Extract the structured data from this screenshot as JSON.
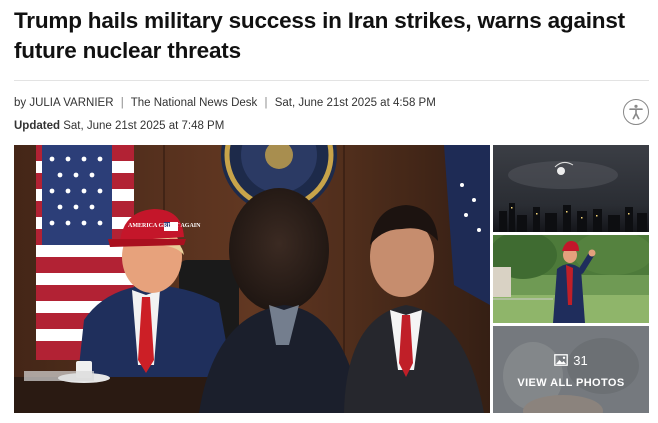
{
  "article": {
    "headline": "Trump hails military success in Iran strikes, warns against future nuclear threats",
    "byline": {
      "prefix": "by",
      "author": "JULIA VARNIER",
      "outlet": "The National News Desk",
      "published": "Sat, June 21st 2025 at 4:58 PM"
    },
    "updated": {
      "label": "Updated",
      "value": "Sat, June 21st 2025 at 7:48 PM"
    }
  },
  "accessibility": {
    "icon": "accessibility-icon"
  },
  "gallery": {
    "photo_count": "31",
    "view_all_label": "VIEW ALL PHOTOS",
    "count_icon": "image-icon",
    "hero_hat_text": "AMERICA GREAT AGAIN"
  }
}
